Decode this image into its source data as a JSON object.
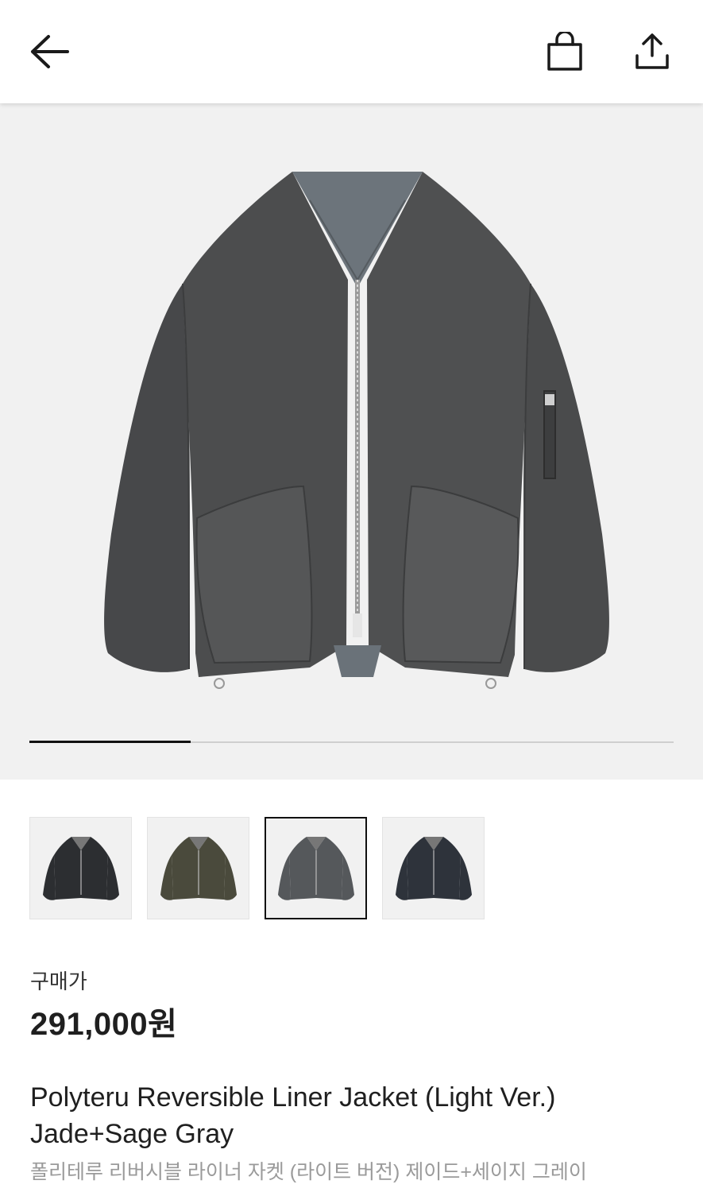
{
  "header": {
    "back_icon": "arrow-left-icon",
    "bag_icon": "shopping-bag-icon",
    "share_icon": "share-upload-icon"
  },
  "gallery": {
    "image_count": 4,
    "current_index": 1,
    "progress_fraction": 0.25,
    "colors": {
      "background": "#f1f1f1",
      "jacket": "#4c4d4e",
      "lining": "#6c747b"
    }
  },
  "thumbnails": [
    {
      "name": "black",
      "color": "#2c2e31",
      "selected": false
    },
    {
      "name": "olive",
      "color": "#4a4a3c",
      "selected": false
    },
    {
      "name": "gray",
      "color": "#55585b",
      "selected": true
    },
    {
      "name": "navy",
      "color": "#2e333b",
      "selected": false
    }
  ],
  "product": {
    "price_label": "구매가",
    "price": "291,000원",
    "title_line1": "Polyteru Reversible Liner Jacket (Light Ver.)",
    "title_line2": "Jade+Sage Gray",
    "korean_name": "폴리테루 리버시블 라이너 자켓 (라이트 버전) 제이드+세이지 그레이"
  }
}
